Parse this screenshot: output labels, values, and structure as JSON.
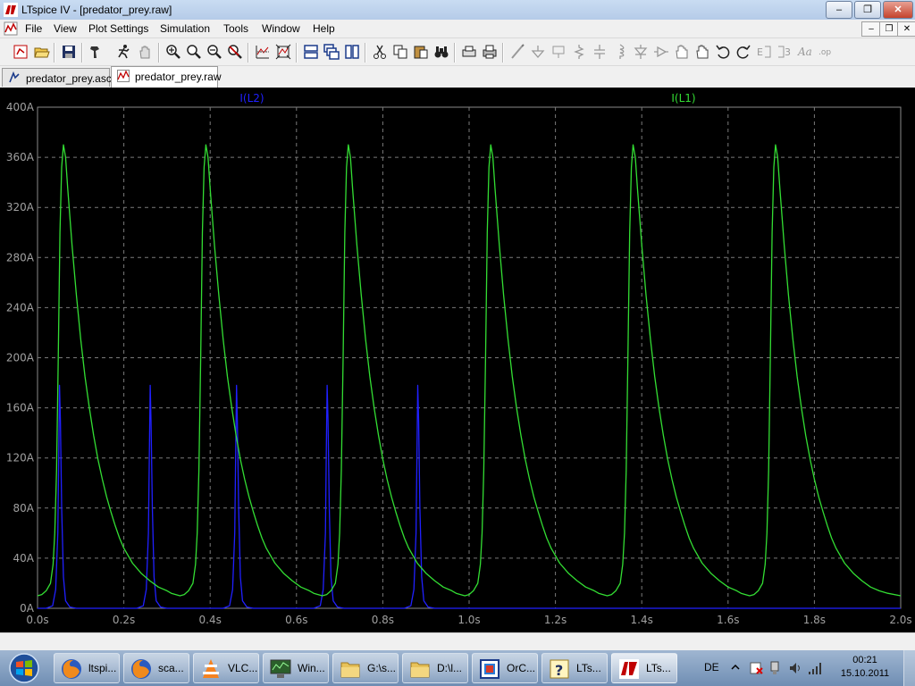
{
  "window": {
    "title": "LTspice IV - [predator_prey.raw]",
    "minimize_glyph": "–",
    "restore_glyph": "❐",
    "close_glyph": "✕"
  },
  "menu": {
    "items": [
      "File",
      "View",
      "Plot Settings",
      "Simulation",
      "Tools",
      "Window",
      "Help"
    ]
  },
  "toolbar": {
    "icons": [
      "new-schematic-icon",
      "open-icon",
      "save-icon",
      "control-panel-icon",
      "run-icon",
      "halt-icon",
      "zoom-in-icon",
      "zoom-area-icon",
      "zoom-out-icon",
      "zoom-cancel-icon",
      "autorange-icon",
      "zoom-fit-icon",
      "tile-horizontal-icon",
      "cascade-icon",
      "tile-vertical-icon",
      "cut-icon",
      "copy-icon",
      "paste-icon",
      "find-icon",
      "print-setup-icon",
      "print-icon",
      "wire-icon",
      "ground-icon",
      "label-icon",
      "resistor-icon",
      "capacitor-icon",
      "inductor-icon",
      "diode-icon",
      "component-icon",
      "move-icon",
      "drag-icon",
      "undo-icon",
      "redo-icon",
      "rotate-icon",
      "mirror-icon",
      "text-icon",
      "spice-directive-icon"
    ]
  },
  "tabs": [
    {
      "label": "predator_prey.asc",
      "icon": "schematic-icon",
      "active": false
    },
    {
      "label": "predator_prey.raw",
      "icon": "waveform-icon",
      "active": true
    }
  ],
  "chart_data": {
    "type": "line",
    "title": "",
    "xlabel": "",
    "ylabel": "",
    "xlim": [
      0.0,
      2.0
    ],
    "ylim": [
      0,
      400
    ],
    "x_ticks": [
      "0.0s",
      "0.2s",
      "0.4s",
      "0.6s",
      "0.8s",
      "1.0s",
      "1.2s",
      "1.4s",
      "1.6s",
      "1.8s",
      "2.0s"
    ],
    "y_ticks": [
      "0A",
      "40A",
      "80A",
      "120A",
      "160A",
      "200A",
      "240A",
      "280A",
      "320A",
      "360A",
      "400A"
    ],
    "grid": true,
    "legend_placement": "top",
    "series": [
      {
        "name": "I(L2)",
        "color": "#2020ff",
        "points": [
          [
            0.0,
            0
          ],
          [
            0.02,
            0
          ],
          [
            0.035,
            2
          ],
          [
            0.042,
            15
          ],
          [
            0.047,
            60
          ],
          [
            0.049,
            120
          ],
          [
            0.051,
            178
          ],
          [
            0.053,
            150
          ],
          [
            0.056,
            80
          ],
          [
            0.06,
            25
          ],
          [
            0.065,
            6
          ],
          [
            0.075,
            1
          ],
          [
            0.09,
            0
          ],
          [
            0.23,
            0
          ],
          [
            0.245,
            2
          ],
          [
            0.252,
            15
          ],
          [
            0.257,
            60
          ],
          [
            0.259,
            120
          ],
          [
            0.261,
            178
          ],
          [
            0.263,
            150
          ],
          [
            0.266,
            80
          ],
          [
            0.27,
            25
          ],
          [
            0.275,
            6
          ],
          [
            0.285,
            1
          ],
          [
            0.3,
            0
          ],
          [
            0.43,
            0
          ],
          [
            0.445,
            2
          ],
          [
            0.452,
            15
          ],
          [
            0.457,
            60
          ],
          [
            0.459,
            120
          ],
          [
            0.461,
            178
          ],
          [
            0.463,
            150
          ],
          [
            0.466,
            80
          ],
          [
            0.47,
            25
          ],
          [
            0.475,
            6
          ],
          [
            0.485,
            1
          ],
          [
            0.5,
            0
          ],
          [
            0.64,
            0
          ],
          [
            0.655,
            2
          ],
          [
            0.662,
            15
          ],
          [
            0.667,
            60
          ],
          [
            0.669,
            120
          ],
          [
            0.671,
            178
          ],
          [
            0.673,
            150
          ],
          [
            0.676,
            80
          ],
          [
            0.68,
            25
          ],
          [
            0.685,
            6
          ],
          [
            0.695,
            1
          ],
          [
            0.71,
            0
          ],
          [
            0.85,
            0
          ],
          [
            0.865,
            2
          ],
          [
            0.872,
            15
          ],
          [
            0.877,
            60
          ],
          [
            0.879,
            120
          ],
          [
            0.881,
            178
          ],
          [
            0.883,
            150
          ],
          [
            0.886,
            80
          ],
          [
            0.89,
            25
          ],
          [
            0.895,
            6
          ],
          [
            0.905,
            1
          ],
          [
            0.92,
            0
          ],
          [
            2.0,
            0
          ]
        ]
      },
      {
        "name": "I(L1)",
        "color": "#33dd33",
        "points": [
          [
            0.0,
            10
          ],
          [
            0.01,
            11
          ],
          [
            0.02,
            14
          ],
          [
            0.03,
            20
          ],
          [
            0.036,
            35
          ],
          [
            0.04,
            60
          ],
          [
            0.044,
            110
          ],
          [
            0.048,
            200
          ],
          [
            0.052,
            300
          ],
          [
            0.056,
            352
          ],
          [
            0.06,
            370
          ],
          [
            0.065,
            360
          ],
          [
            0.07,
            335
          ],
          [
            0.08,
            290
          ],
          [
            0.09,
            250
          ],
          [
            0.1,
            215
          ],
          [
            0.11,
            185
          ],
          [
            0.12,
            160
          ],
          [
            0.13,
            138
          ],
          [
            0.14,
            119
          ],
          [
            0.15,
            103
          ],
          [
            0.16,
            89
          ],
          [
            0.17,
            77
          ],
          [
            0.18,
            66
          ],
          [
            0.19,
            56
          ],
          [
            0.2,
            48
          ],
          [
            0.22,
            36
          ],
          [
            0.24,
            28
          ],
          [
            0.26,
            22
          ],
          [
            0.28,
            17
          ],
          [
            0.3,
            14
          ],
          [
            0.31,
            12
          ],
          [
            0.32,
            11
          ],
          [
            0.33,
            10
          ],
          [
            0.34,
            11
          ],
          [
            0.35,
            14
          ],
          [
            0.36,
            20
          ],
          [
            0.366,
            35
          ],
          [
            0.37,
            60
          ],
          [
            0.374,
            110
          ],
          [
            0.378,
            200
          ],
          [
            0.382,
            300
          ],
          [
            0.386,
            352
          ],
          [
            0.39,
            370
          ],
          [
            0.395,
            360
          ],
          [
            0.4,
            335
          ],
          [
            0.41,
            290
          ],
          [
            0.42,
            250
          ],
          [
            0.43,
            215
          ],
          [
            0.44,
            185
          ],
          [
            0.45,
            160
          ],
          [
            0.46,
            138
          ],
          [
            0.47,
            119
          ],
          [
            0.48,
            103
          ],
          [
            0.49,
            89
          ],
          [
            0.5,
            77
          ],
          [
            0.51,
            66
          ],
          [
            0.52,
            56
          ],
          [
            0.53,
            48
          ],
          [
            0.55,
            36
          ],
          [
            0.57,
            28
          ],
          [
            0.59,
            22
          ],
          [
            0.61,
            17
          ],
          [
            0.63,
            14
          ],
          [
            0.64,
            12
          ],
          [
            0.65,
            11
          ],
          [
            0.66,
            10
          ],
          [
            0.67,
            11
          ],
          [
            0.68,
            14
          ],
          [
            0.69,
            20
          ],
          [
            0.696,
            35
          ],
          [
            0.7,
            60
          ],
          [
            0.704,
            110
          ],
          [
            0.708,
            200
          ],
          [
            0.712,
            300
          ],
          [
            0.716,
            352
          ],
          [
            0.72,
            370
          ],
          [
            0.725,
            360
          ],
          [
            0.73,
            335
          ],
          [
            0.74,
            290
          ],
          [
            0.75,
            250
          ],
          [
            0.76,
            215
          ],
          [
            0.77,
            185
          ],
          [
            0.78,
            160
          ],
          [
            0.79,
            138
          ],
          [
            0.8,
            119
          ],
          [
            0.81,
            103
          ],
          [
            0.82,
            89
          ],
          [
            0.83,
            77
          ],
          [
            0.84,
            66
          ],
          [
            0.85,
            56
          ],
          [
            0.86,
            48
          ],
          [
            0.88,
            36
          ],
          [
            0.9,
            28
          ],
          [
            0.92,
            22
          ],
          [
            0.94,
            17
          ],
          [
            0.96,
            14
          ],
          [
            0.97,
            12
          ],
          [
            0.98,
            11
          ],
          [
            0.99,
            10
          ],
          [
            1.0,
            11
          ],
          [
            1.01,
            14
          ],
          [
            1.02,
            20
          ],
          [
            1.026,
            35
          ],
          [
            1.03,
            60
          ],
          [
            1.034,
            110
          ],
          [
            1.038,
            200
          ],
          [
            1.042,
            300
          ],
          [
            1.046,
            352
          ],
          [
            1.05,
            370
          ],
          [
            1.055,
            360
          ],
          [
            1.06,
            335
          ],
          [
            1.07,
            290
          ],
          [
            1.08,
            250
          ],
          [
            1.09,
            215
          ],
          [
            1.1,
            185
          ],
          [
            1.11,
            160
          ],
          [
            1.12,
            138
          ],
          [
            1.13,
            119
          ],
          [
            1.14,
            103
          ],
          [
            1.15,
            89
          ],
          [
            1.16,
            77
          ],
          [
            1.17,
            66
          ],
          [
            1.18,
            56
          ],
          [
            1.19,
            48
          ],
          [
            1.21,
            36
          ],
          [
            1.23,
            28
          ],
          [
            1.25,
            22
          ],
          [
            1.27,
            17
          ],
          [
            1.29,
            14
          ],
          [
            1.3,
            12
          ],
          [
            1.31,
            11
          ],
          [
            1.32,
            10
          ],
          [
            1.33,
            11
          ],
          [
            1.34,
            14
          ],
          [
            1.35,
            20
          ],
          [
            1.356,
            35
          ],
          [
            1.36,
            60
          ],
          [
            1.364,
            110
          ],
          [
            1.368,
            200
          ],
          [
            1.372,
            300
          ],
          [
            1.376,
            352
          ],
          [
            1.38,
            370
          ],
          [
            1.385,
            360
          ],
          [
            1.39,
            335
          ],
          [
            1.4,
            290
          ],
          [
            1.41,
            250
          ],
          [
            1.42,
            215
          ],
          [
            1.43,
            185
          ],
          [
            1.44,
            160
          ],
          [
            1.45,
            138
          ],
          [
            1.46,
            119
          ],
          [
            1.47,
            103
          ],
          [
            1.48,
            89
          ],
          [
            1.49,
            77
          ],
          [
            1.5,
            66
          ],
          [
            1.51,
            56
          ],
          [
            1.52,
            48
          ],
          [
            1.54,
            36
          ],
          [
            1.56,
            28
          ],
          [
            1.58,
            22
          ],
          [
            1.6,
            17
          ],
          [
            1.62,
            14
          ],
          [
            1.63,
            12
          ],
          [
            1.64,
            11
          ],
          [
            1.65,
            10
          ],
          [
            1.66,
            11
          ],
          [
            1.67,
            14
          ],
          [
            1.68,
            20
          ],
          [
            1.686,
            35
          ],
          [
            1.69,
            60
          ],
          [
            1.694,
            110
          ],
          [
            1.698,
            200
          ],
          [
            1.702,
            300
          ],
          [
            1.706,
            352
          ],
          [
            1.71,
            370
          ],
          [
            1.715,
            360
          ],
          [
            1.72,
            335
          ],
          [
            1.73,
            290
          ],
          [
            1.74,
            250
          ],
          [
            1.75,
            215
          ],
          [
            1.76,
            185
          ],
          [
            1.77,
            160
          ],
          [
            1.78,
            138
          ],
          [
            1.79,
            119
          ],
          [
            1.8,
            103
          ],
          [
            1.81,
            89
          ],
          [
            1.82,
            77
          ],
          [
            1.83,
            66
          ],
          [
            1.84,
            56
          ],
          [
            1.85,
            48
          ],
          [
            1.87,
            36
          ],
          [
            1.89,
            28
          ],
          [
            1.91,
            22
          ],
          [
            1.93,
            17
          ],
          [
            1.95,
            14
          ],
          [
            1.97,
            12
          ],
          [
            2.0,
            10
          ]
        ]
      }
    ]
  },
  "taskbar": {
    "items": [
      {
        "label": "ltspi...",
        "icon": "firefox-icon"
      },
      {
        "label": "sca...",
        "icon": "firefox-icon"
      },
      {
        "label": "VLC...",
        "icon": "vlc-icon"
      },
      {
        "label": "Win...",
        "icon": "monitor-icon"
      },
      {
        "label": "G:\\s...",
        "icon": "folder-icon"
      },
      {
        "label": "D:\\l...",
        "icon": "folder-icon"
      },
      {
        "label": "OrC...",
        "icon": "orcad-icon"
      },
      {
        "label": "LTs...",
        "icon": "help-icon"
      },
      {
        "label": "LTs...",
        "icon": "ltspice-icon"
      }
    ],
    "language": "DE",
    "time": "00:21",
    "date": "15.10.2011"
  }
}
